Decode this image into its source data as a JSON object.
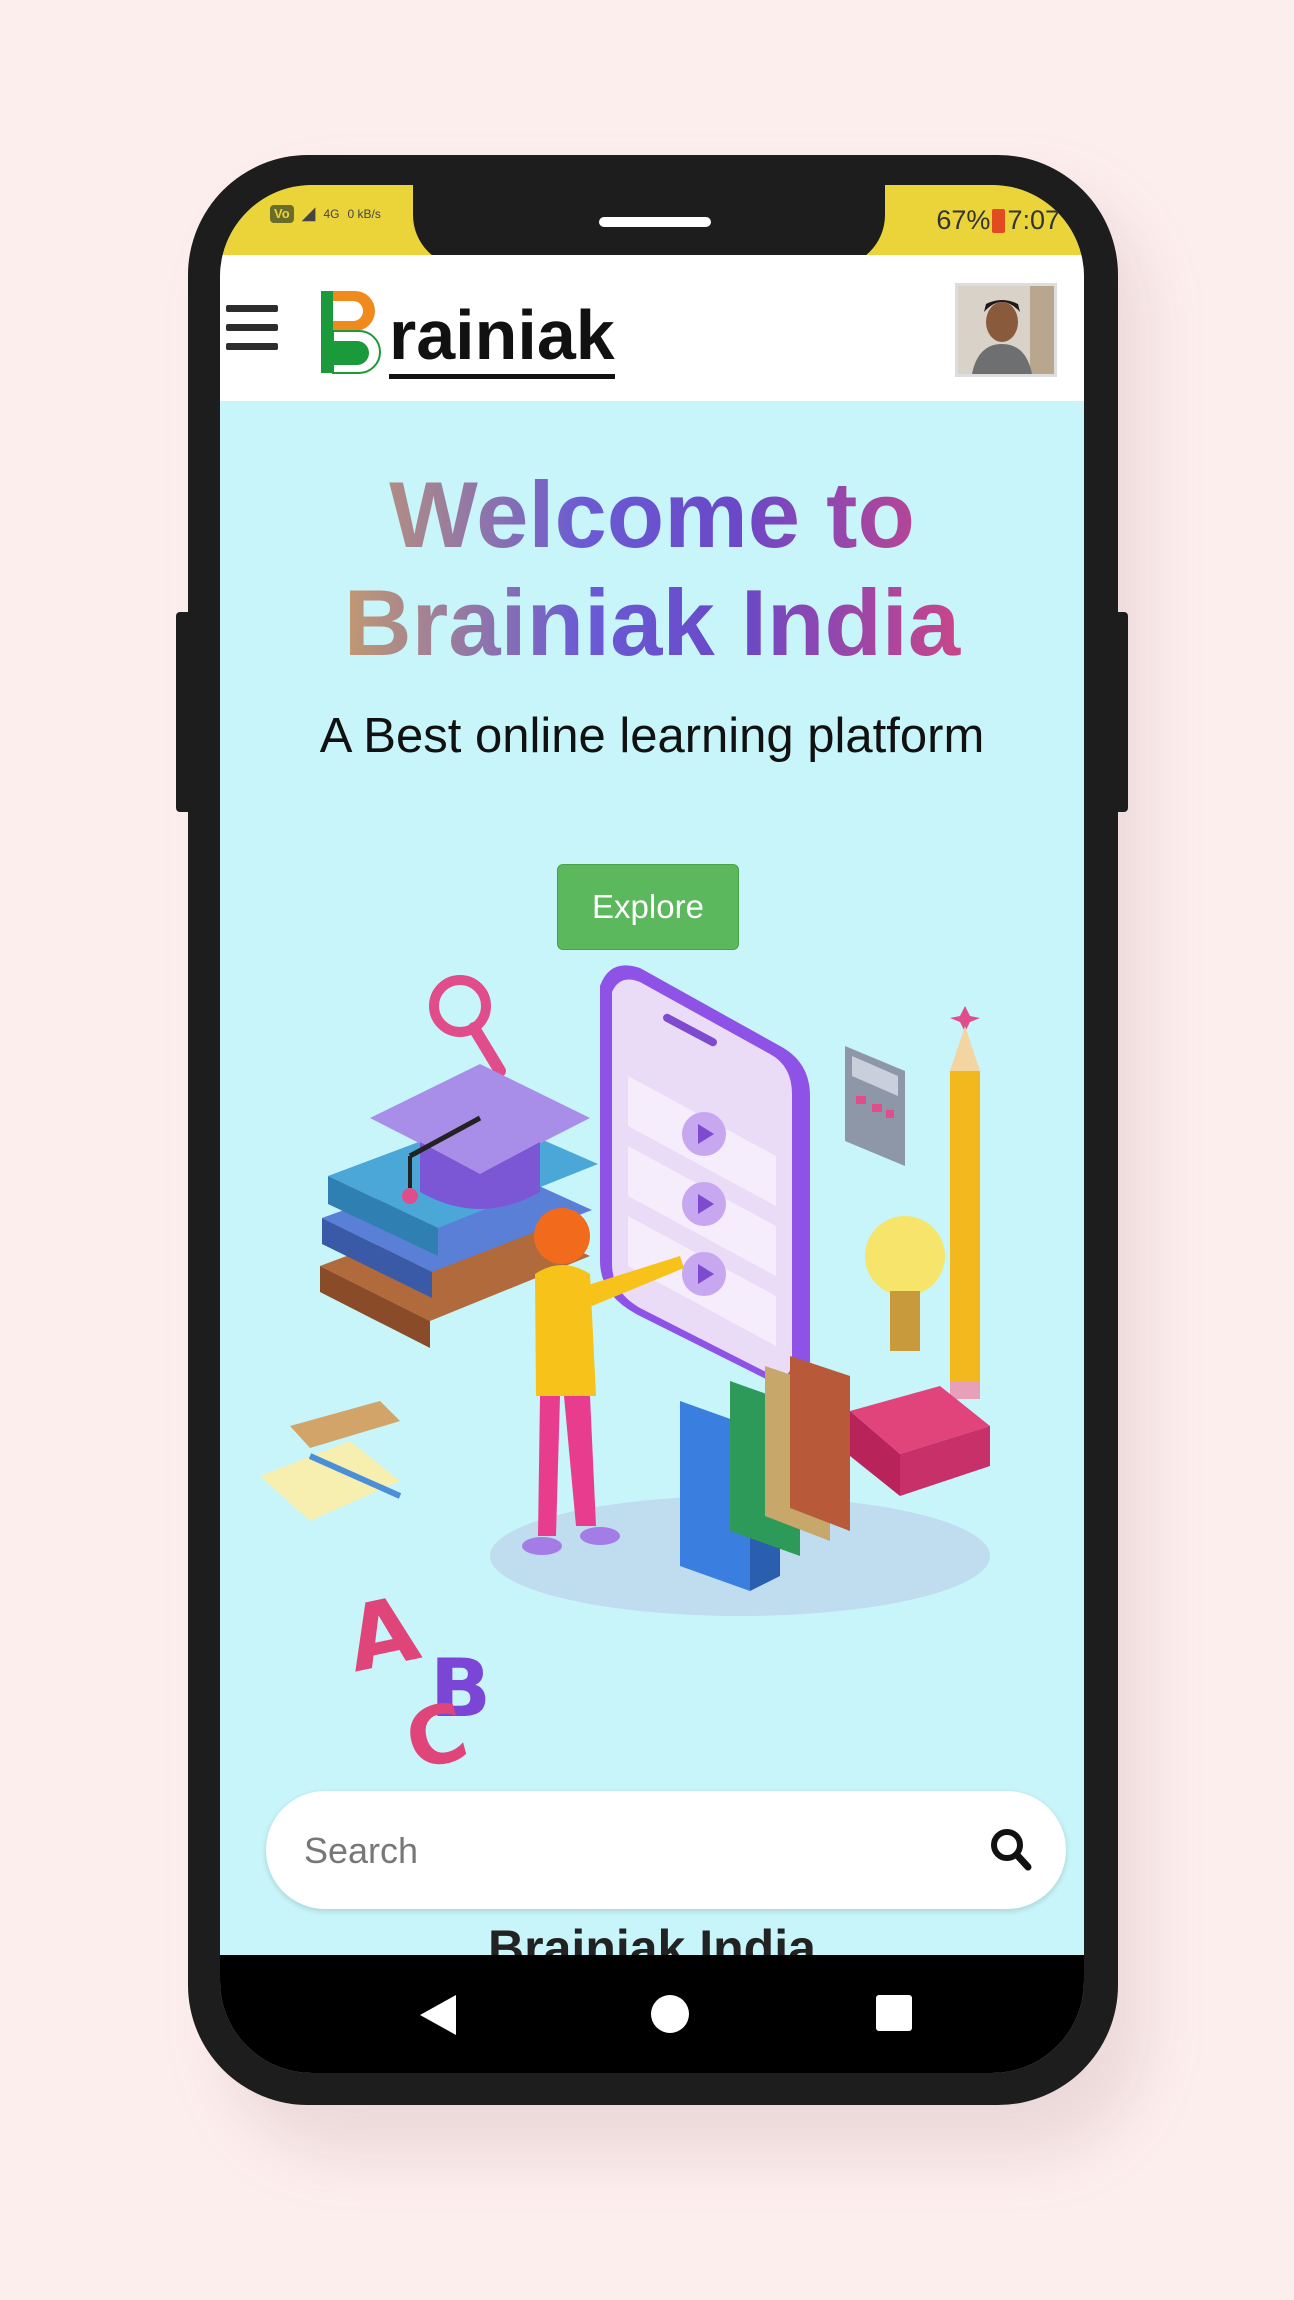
{
  "status_bar": {
    "volte": "VoLTE",
    "network": "4G",
    "speed": "0 kB/s",
    "battery": "67%",
    "time": "7:07"
  },
  "header": {
    "menu_icon": "hamburger-icon",
    "logo_text": "rainiak",
    "avatar": "user-avatar"
  },
  "hero": {
    "welcome_line1": "Welcome to",
    "welcome_line2": "Brainiak India",
    "tagline": "A Best online learning platform",
    "explore_label": "Explore"
  },
  "search": {
    "placeholder": "Search",
    "icon": "search-icon"
  },
  "section_peek": "Brainiak India",
  "nav": {
    "back": "back-icon",
    "home": "home-icon",
    "recent": "recent-apps-icon"
  },
  "colors": {
    "background": "#fdeeee",
    "screen": "#c7f5f9",
    "status_bar": "#ead43a",
    "button": "#5cb85c"
  }
}
